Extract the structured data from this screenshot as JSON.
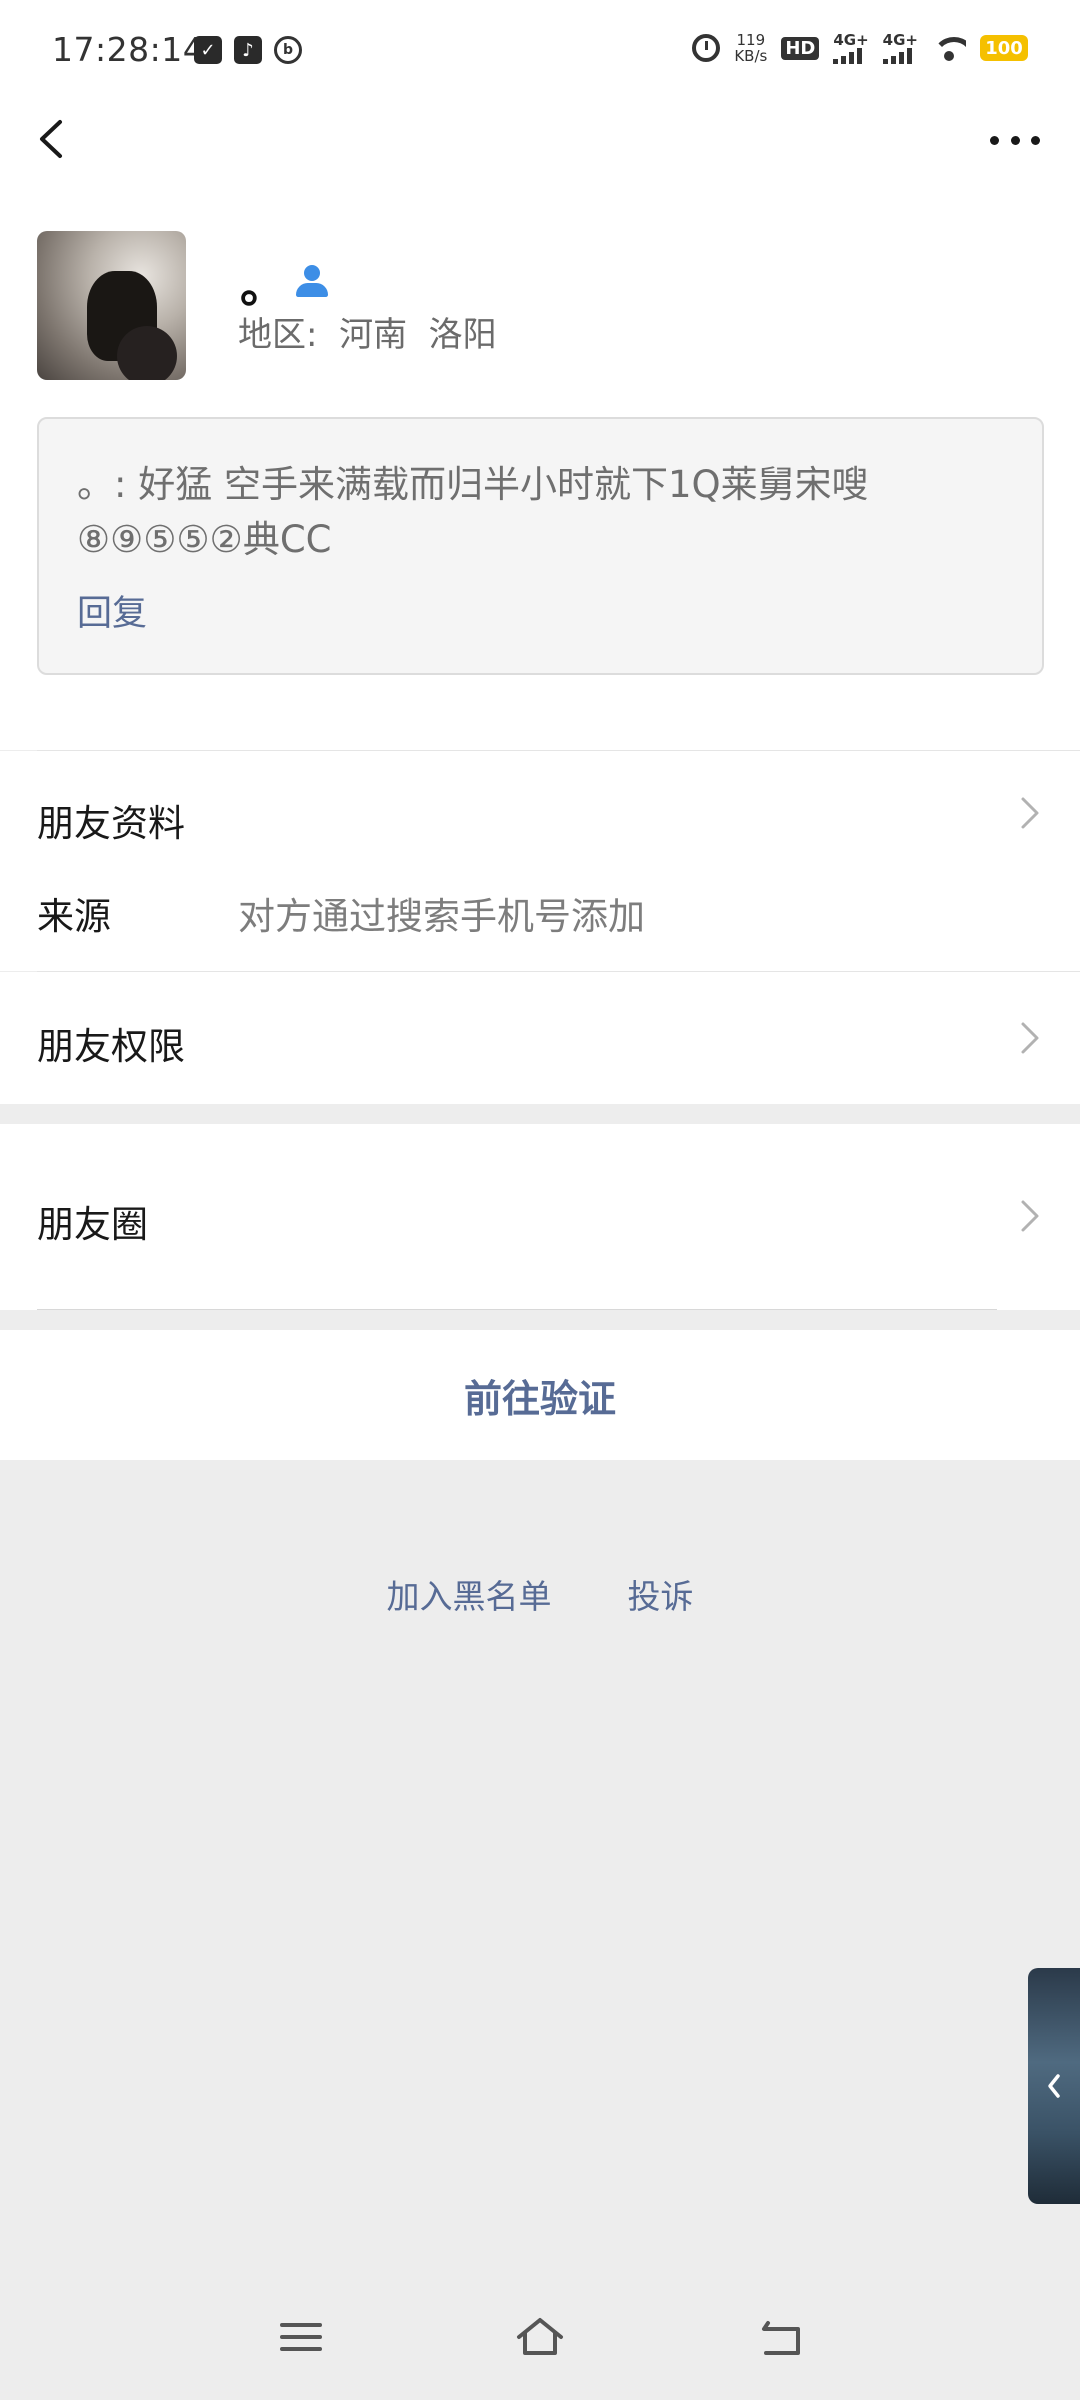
{
  "status_bar": {
    "time": "17:28:14",
    "net_speed_value": "119",
    "net_speed_unit": "KB/s",
    "hd_label": "HD",
    "network_1": "4G+",
    "network_2": "4G+",
    "battery": "100",
    "icons": [
      "clipboard-check-icon",
      "tiktok-icon",
      "circle-logo-icon",
      "alarm-icon",
      "hd-icon",
      "signal-icon",
      "wifi-icon",
      "battery-icon"
    ]
  },
  "nav": {
    "back_icon": "chevron-left-icon",
    "more_icon": "more-dots-icon"
  },
  "profile": {
    "name": "。",
    "region": "地区:  河南  洛阳",
    "badge_icon": "person-icon"
  },
  "message": {
    "text": "。: 好猛  空手来满载而归半小时就下1Q莱舅宋嗖⑧⑨⑤⑤②典CC",
    "reply": "回复"
  },
  "rows": {
    "friend_info": "朋友资料",
    "source_label": "来源",
    "source_value": "对方通过搜索手机号添加",
    "friend_permissions": "朋友权限",
    "moments": "朋友圈"
  },
  "verify_button": "前往验证",
  "bottom_links": {
    "blacklist": "加入黑名单",
    "report": "投诉"
  },
  "colors": {
    "link": "#576b95",
    "background": "#ededed",
    "battery": "#f5c000",
    "badge": "#3d8ee6"
  }
}
